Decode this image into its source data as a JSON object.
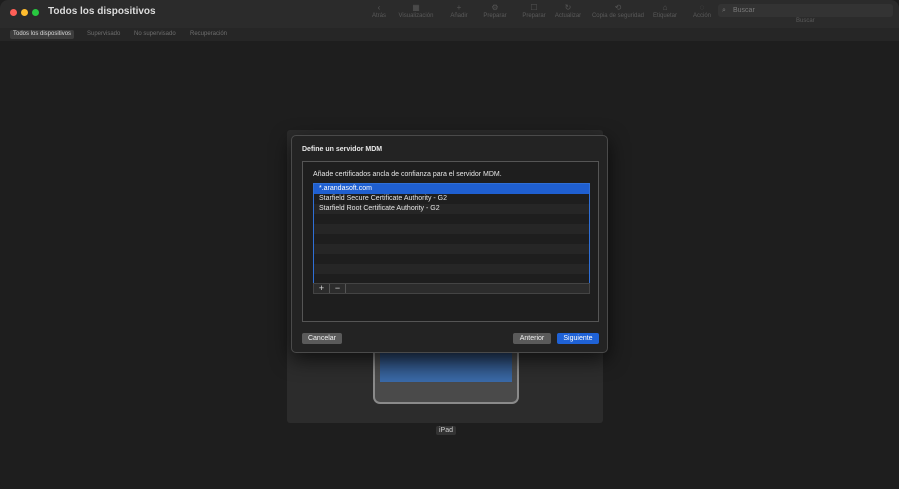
{
  "window": {
    "title": "Todos los dispositivos"
  },
  "toolbar": {
    "items": [
      {
        "label": "Atrás",
        "icon": "chevron-left-icon",
        "glyph": "‹"
      },
      {
        "label": "Visualización",
        "icon": "view-icon",
        "glyph": "▦"
      },
      {
        "label": "Añadir",
        "icon": "add-icon",
        "glyph": "+"
      },
      {
        "label": "Preparar",
        "icon": "prepare-icon",
        "glyph": "⚙"
      },
      {
        "label": "Preparar",
        "icon": "prepare-icon-2",
        "glyph": "☐"
      },
      {
        "label": "Actualizar",
        "icon": "update-icon",
        "glyph": "↻"
      },
      {
        "label": "Copia de seguridad",
        "icon": "backup-icon",
        "glyph": "⟲"
      },
      {
        "label": "Etiquetar",
        "icon": "tag-icon",
        "glyph": "⌂"
      },
      {
        "label": "Acción",
        "icon": "action-icon",
        "glyph": "◌"
      }
    ],
    "search_placeholder": "Buscar",
    "search_caption": "Buscar"
  },
  "tabs": [
    "Todos los dispositivos",
    "Supervisado",
    "No supervisado",
    "Recuperación"
  ],
  "device": {
    "label": "iPad"
  },
  "dialog": {
    "title": "Define un servidor MDM",
    "instruction": "Añade certificados ancla de confianza para el servidor MDM.",
    "certificates": [
      "*.arandasoft.com",
      "Starfield Secure Certificate Authority - G2",
      "Starfield Root Certificate Authority - G2"
    ],
    "add_label": "+",
    "remove_label": "−",
    "cancel_label": "Cancelar",
    "back_label": "Anterior",
    "next_label": "Siguiente"
  },
  "colors": {
    "accent": "#1f62d6",
    "selection": "#1f5fd0",
    "background": "#1e1e1e"
  }
}
